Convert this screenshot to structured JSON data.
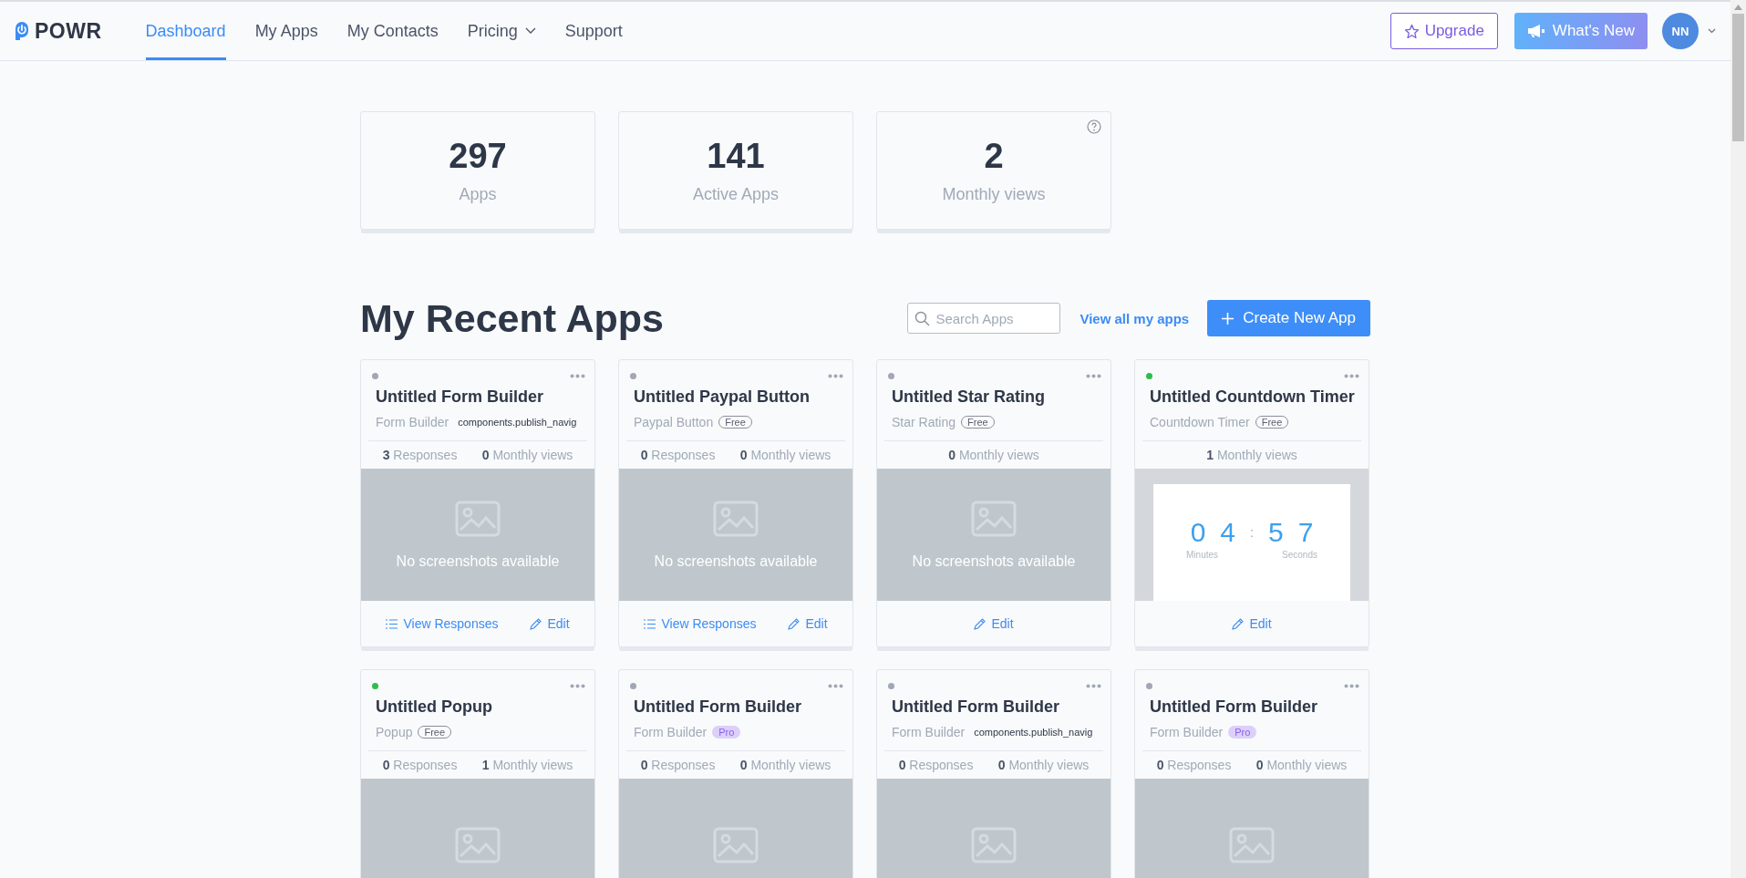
{
  "header": {
    "logo": "POWR",
    "nav": [
      {
        "label": "Dashboard",
        "selected": true,
        "dropdown": false
      },
      {
        "label": "My Apps",
        "selected": false,
        "dropdown": false
      },
      {
        "label": "My Contacts",
        "selected": false,
        "dropdown": false
      },
      {
        "label": "Pricing",
        "selected": false,
        "dropdown": true
      },
      {
        "label": "Support",
        "selected": false,
        "dropdown": false
      }
    ],
    "upgrade": "Upgrade",
    "whats_new": "What's New",
    "avatar": "NN"
  },
  "stats": [
    {
      "value": "297",
      "label": "Apps",
      "help": false
    },
    {
      "value": "141",
      "label": "Active Apps",
      "help": false
    },
    {
      "value": "2",
      "label": "Monthly views",
      "help": true
    }
  ],
  "recent": {
    "title": "My Recent Apps",
    "search": {
      "placeholder": "Search Apps"
    },
    "view_all": "View all my apps",
    "create": "Create New App",
    "apps": [
      {
        "color": "#a0a7b5",
        "title": "Untitled Form Builder",
        "type": "Form Builder",
        "tag": {
          "kind": "text",
          "label": "components.publish_navig"
        },
        "stats": [
          {
            "count": "3",
            "label": "Responses"
          },
          {
            "count": "0",
            "label": "Monthly views"
          }
        ],
        "preview": {
          "kind": "placeholder",
          "text": "No screenshots available"
        },
        "actions": [
          {
            "kind": "responses",
            "label": "View Responses"
          },
          {
            "kind": "edit",
            "label": "Edit"
          }
        ]
      },
      {
        "color": "#a0a7b5",
        "title": "Untitled Paypal Button",
        "type": "Paypal Button",
        "tag": {
          "kind": "free",
          "label": "Free"
        },
        "stats": [
          {
            "count": "0",
            "label": "Responses"
          },
          {
            "count": "0",
            "label": "Monthly views"
          }
        ],
        "preview": {
          "kind": "placeholder",
          "text": "No screenshots available"
        },
        "actions": [
          {
            "kind": "responses",
            "label": "View Responses"
          },
          {
            "kind": "edit",
            "label": "Edit"
          }
        ]
      },
      {
        "color": "#a0a7b5",
        "title": "Untitled Star Rating",
        "type": "Star Rating",
        "tag": {
          "kind": "free",
          "label": "Free"
        },
        "stats": [
          {
            "count": "0",
            "label": "Monthly views"
          }
        ],
        "preview": {
          "kind": "placeholder",
          "text": "No screenshots available"
        },
        "actions": [
          {
            "kind": "edit",
            "label": "Edit"
          }
        ]
      },
      {
        "color": "#2ebd4e",
        "title": "Untitled Countdown Timer",
        "type": "Countdown Timer",
        "tag": {
          "kind": "free",
          "label": "Free"
        },
        "stats": [
          {
            "count": "1",
            "label": "Monthly views"
          }
        ],
        "preview": {
          "kind": "countdown",
          "digits": [
            "0",
            "4",
            "5",
            "7"
          ],
          "separator": ":",
          "labels": [
            "Minutes",
            "Seconds"
          ]
        },
        "actions": [
          {
            "kind": "edit",
            "label": "Edit"
          }
        ]
      },
      {
        "color": "#2ebd4e",
        "title": "Untitled Popup",
        "type": "Popup",
        "tag": {
          "kind": "free",
          "label": "Free"
        },
        "stats": [
          {
            "count": "0",
            "label": "Responses"
          },
          {
            "count": "1",
            "label": "Monthly views"
          }
        ],
        "preview": {
          "kind": "placeholder"
        }
      },
      {
        "color": "#a0a7b5",
        "title": "Untitled Form Builder",
        "type": "Form Builder",
        "tag": {
          "kind": "pro",
          "label": "Pro"
        },
        "stats": [
          {
            "count": "0",
            "label": "Responses"
          },
          {
            "count": "0",
            "label": "Monthly views"
          }
        ],
        "preview": {
          "kind": "placeholder"
        }
      },
      {
        "color": "#a0a7b5",
        "title": "Untitled Form Builder",
        "type": "Form Builder",
        "tag": {
          "kind": "text",
          "label": "components.publish_navig"
        },
        "stats": [
          {
            "count": "0",
            "label": "Responses"
          },
          {
            "count": "0",
            "label": "Monthly views"
          }
        ],
        "preview": {
          "kind": "placeholder"
        }
      },
      {
        "color": "#a0a7b5",
        "title": "Untitled Form Builder",
        "type": "Form Builder",
        "tag": {
          "kind": "pro",
          "label": "Pro"
        },
        "stats": [
          {
            "count": "0",
            "label": "Responses"
          },
          {
            "count": "0",
            "label": "Monthly views"
          }
        ],
        "preview": {
          "kind": "placeholder"
        }
      }
    ]
  }
}
